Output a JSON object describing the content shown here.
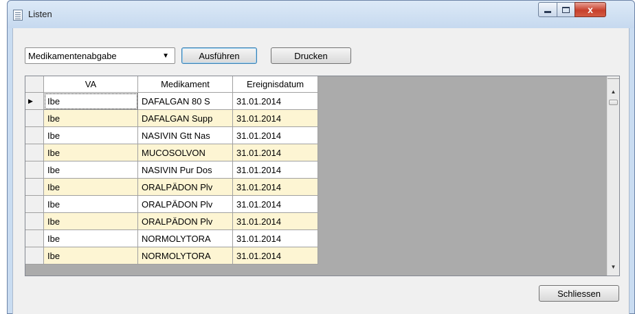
{
  "window": {
    "title": "Listen",
    "title_icon": "list-window-icon",
    "controls": {
      "minimize": "minimize-icon",
      "maximize": "maximize-icon",
      "close": "x"
    }
  },
  "toolbar": {
    "combo_value": "Medikamentenabgabe",
    "execute_label": "Ausführen",
    "print_label": "Drucken"
  },
  "grid": {
    "columns": [
      "VA",
      "Medikament",
      "Ereignisdatum"
    ],
    "current_row_marker": "▶",
    "rows": [
      [
        "Ibe",
        "DAFALGAN 80 S",
        "31.01.2014"
      ],
      [
        "Ibe",
        "DAFALGAN Supp",
        "31.01.2014"
      ],
      [
        "Ibe",
        "NASIVIN Gtt Nas",
        "31.01.2014"
      ],
      [
        "Ibe",
        "MUCOSOLVON",
        "31.01.2014"
      ],
      [
        "Ibe",
        "NASIVIN Pur Dos",
        "31.01.2014"
      ],
      [
        "Ibe",
        "ORALPÄDON Plv",
        "31.01.2014"
      ],
      [
        "Ibe",
        "ORALPÄDON Plv",
        "31.01.2014"
      ],
      [
        "Ibe",
        "ORALPÄDON Plv",
        "31.01.2014"
      ],
      [
        "Ibe",
        "NORMOLYTORA",
        "31.01.2014"
      ],
      [
        "Ibe",
        "NORMOLYTORA",
        "31.01.2014"
      ]
    ],
    "row_colors": {
      "odd": "#ffffff",
      "even": "#fdf5d3"
    }
  },
  "footer": {
    "close_label": "Schliessen"
  }
}
